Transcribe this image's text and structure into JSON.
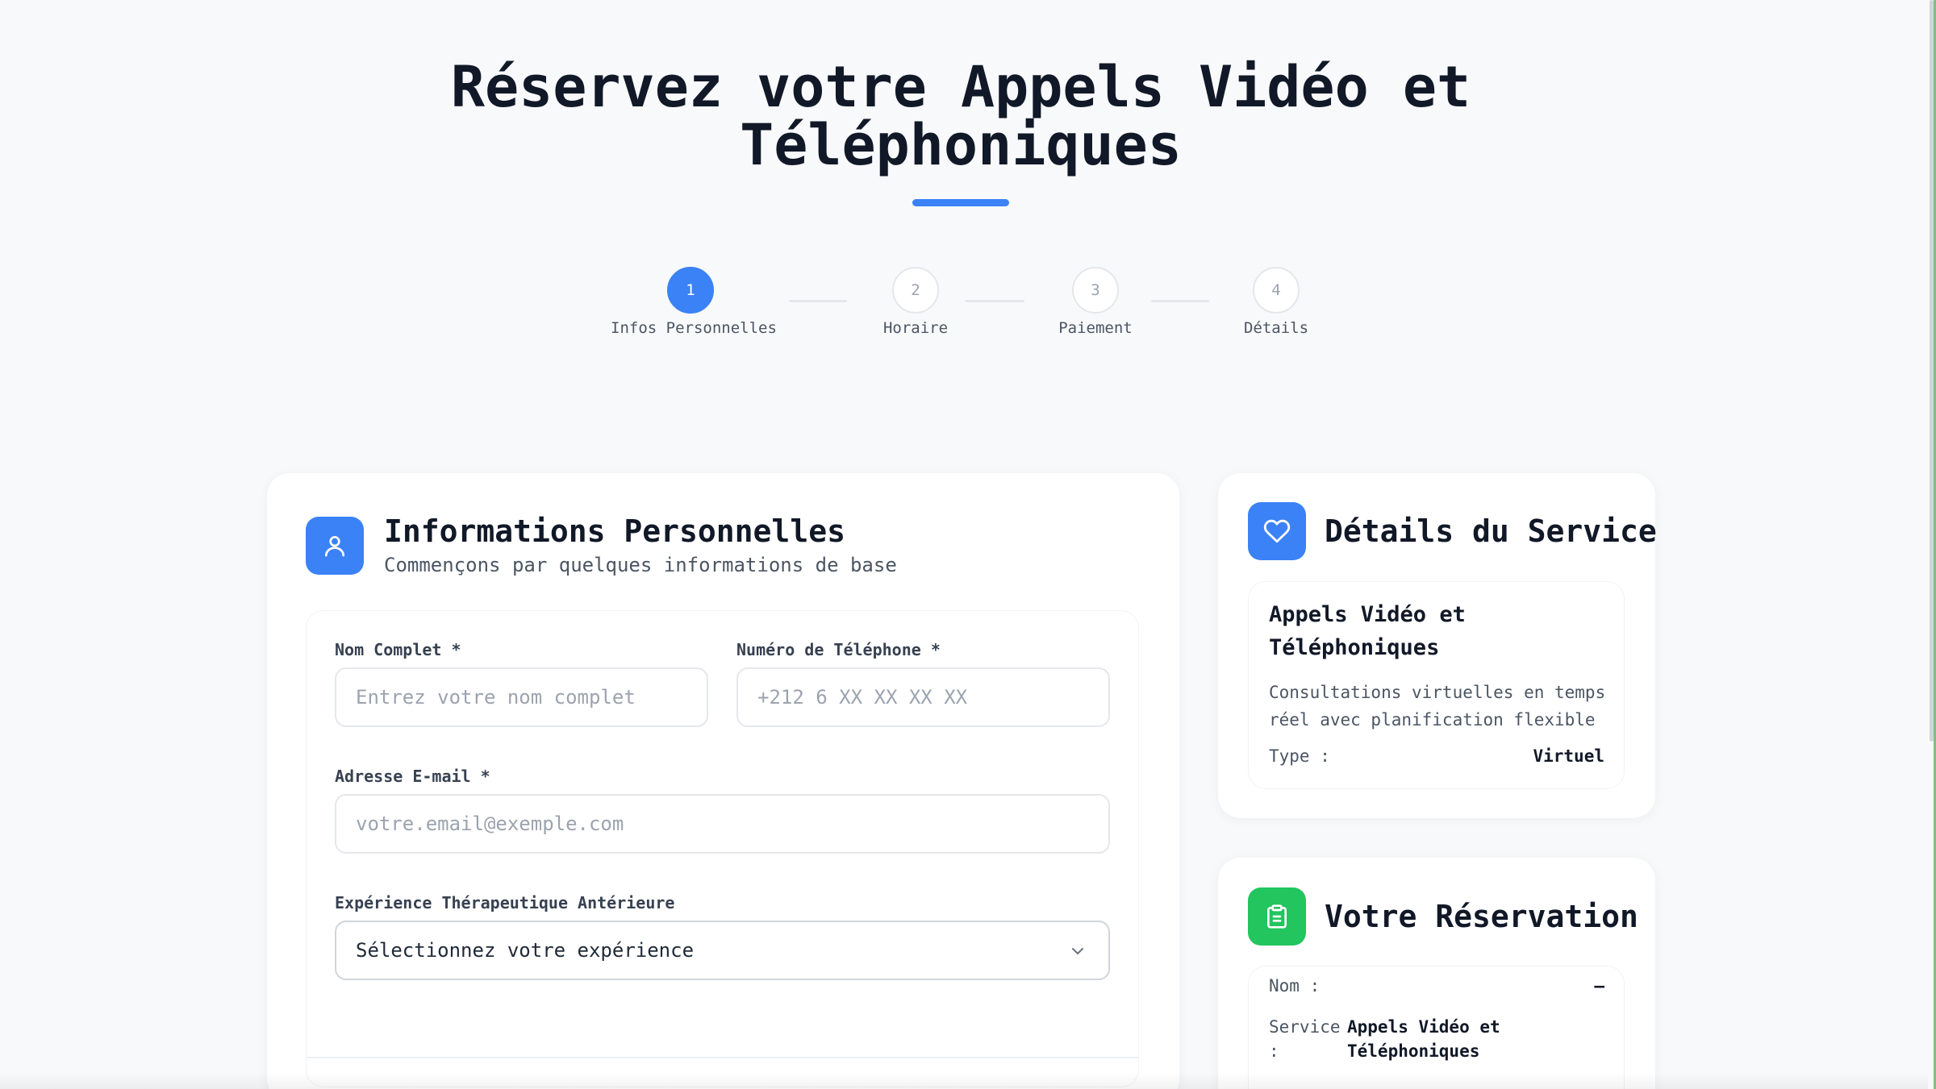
{
  "header": {
    "title_line1": "Réservez votre Appels Vidéo et",
    "title_line2": "Téléphoniques",
    "accent_color": "#3b82f6"
  },
  "steps": [
    {
      "number": "1",
      "label": "Infos Personnelles",
      "active": true
    },
    {
      "number": "2",
      "label": "Horaire",
      "active": false
    },
    {
      "number": "3",
      "label": "Paiement",
      "active": false
    },
    {
      "number": "4",
      "label": "Détails",
      "active": false
    }
  ],
  "personal_info": {
    "icon": "user-icon",
    "title": "Informations Personnelles",
    "subtitle": "Commençons par quelques informations de base",
    "fields": {
      "full_name": {
        "label": "Nom Complet *",
        "placeholder": "Entrez votre nom complet",
        "value": ""
      },
      "phone": {
        "label": "Numéro de Téléphone *",
        "placeholder": "+212 6 XX XX XX XX",
        "value": ""
      },
      "email": {
        "label": "Adresse E-mail *",
        "placeholder": "votre.email@exemple.com",
        "value": ""
      },
      "experience": {
        "label": "Expérience Thérapeutique Antérieure",
        "selected": "Sélectionnez votre expérience"
      }
    }
  },
  "service_details": {
    "icon": "heart-icon",
    "title": "Détails du Service",
    "service_name_line1": "Appels Vidéo et",
    "service_name_line2": "Téléphoniques",
    "description_line1": "Consultations virtuelles en temps",
    "description_line2": "réel avec planification flexible",
    "type_label": "Type :",
    "type_value": "Virtuel"
  },
  "reservation": {
    "icon": "clipboard-icon",
    "title": "Votre Réservation",
    "name_label": "Nom :",
    "name_value": "–",
    "service_label_line1": "Service",
    "service_label_line2": ":",
    "service_value_line1": "Appels Vidéo et",
    "service_value_line2": "Téléphoniques",
    "icon_color": "#22c55e"
  }
}
